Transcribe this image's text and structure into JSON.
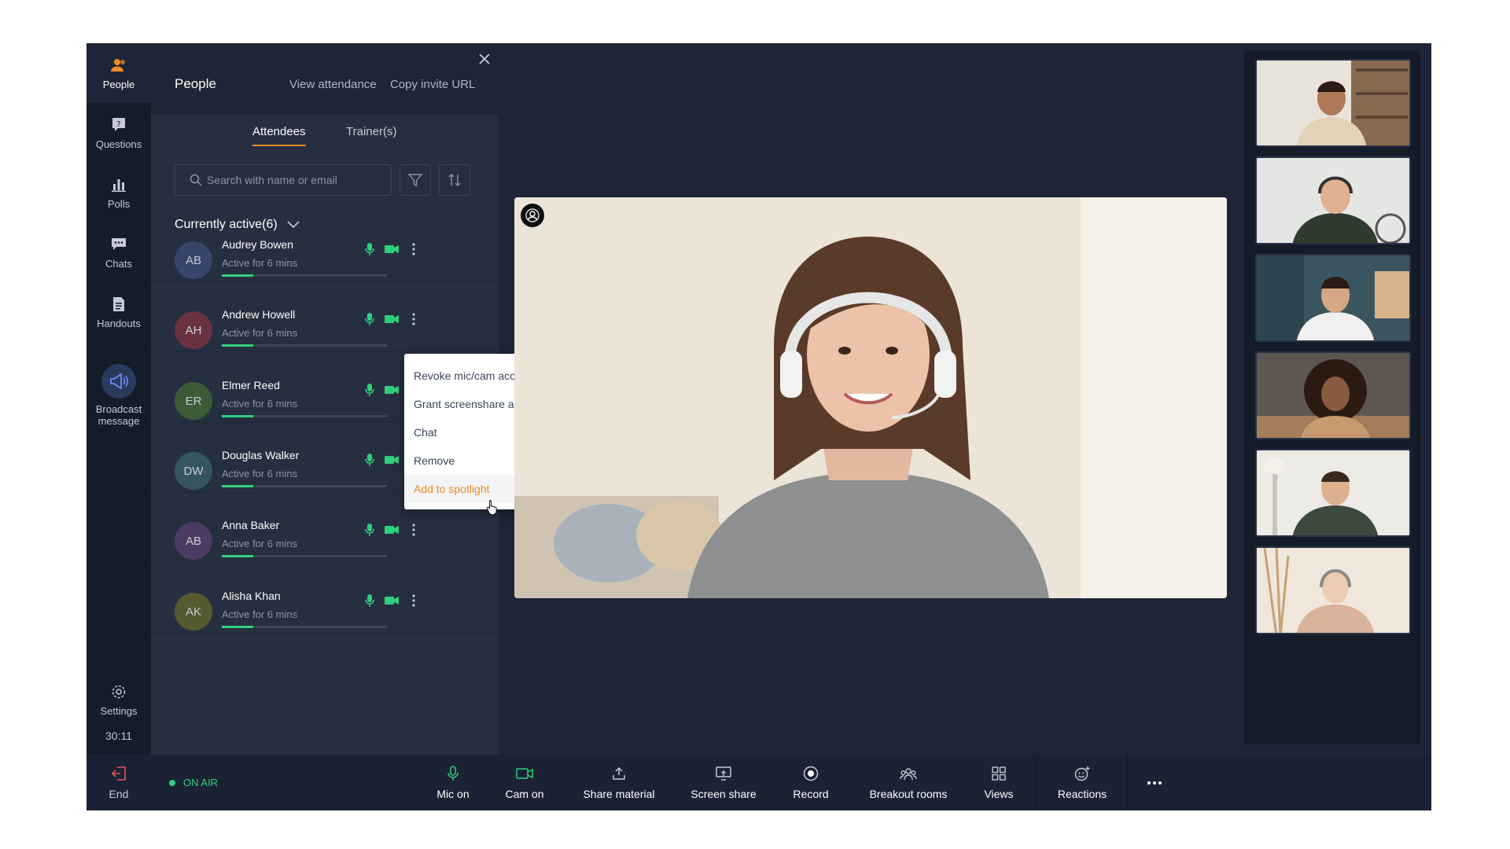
{
  "colors": {
    "accent": "#f08a24",
    "green": "#2fd07c",
    "end_red": "#e8515c"
  },
  "rail": {
    "items": [
      {
        "label": "People",
        "icon": "people-icon",
        "active": true
      },
      {
        "label": "Questions",
        "icon": "question-icon"
      },
      {
        "label": "Polls",
        "icon": "poll-icon"
      },
      {
        "label": "Chats",
        "icon": "chat-icon"
      },
      {
        "label": "Handouts",
        "icon": "document-icon"
      }
    ],
    "broadcast_label": "Broadcast message",
    "settings_label": "Settings",
    "timer": "30:11",
    "end_label": "End"
  },
  "panel": {
    "title": "People",
    "view_attendance": "View attendance",
    "copy_invite": "Copy invite URL",
    "tabs": [
      "Attendees",
      "Trainer(s)"
    ],
    "search_placeholder": "Search with name or email",
    "section_label": "Currently active(6)"
  },
  "people": [
    {
      "initials": "AB",
      "name": "Audrey Bowen",
      "status": "Active for 6 mins",
      "progress": 0.19,
      "avatar_color": "#38456a"
    },
    {
      "initials": "AH",
      "name": "Andrew Howell",
      "status": "Active for 6 mins",
      "progress": 0.19,
      "avatar_color": "#6a3240"
    },
    {
      "initials": "ER",
      "name": "Elmer Reed",
      "status": "Active for 6 mins",
      "progress": 0.19,
      "avatar_color": "#3b5a35"
    },
    {
      "initials": "DW",
      "name": "Douglas Walker",
      "status": "Active for 6 mins",
      "progress": 0.19,
      "avatar_color": "#34565e"
    },
    {
      "initials": "AB",
      "name": "Anna Baker",
      "status": "Active for 6 mins",
      "progress": 0.19,
      "avatar_color": "#4c3a64"
    },
    {
      "initials": "AK",
      "name": "Alisha Khan",
      "status": "Active for 6 mins",
      "progress": 0.19,
      "avatar_color": "#555a30"
    }
  ],
  "menu": {
    "items": [
      "Revoke mic/cam access",
      "Grant screenshare access",
      "Chat",
      "Remove",
      "Add to spotlight"
    ],
    "highlighted": "Add to spotlight"
  },
  "bottom": {
    "on_air": "ON AIR",
    "buttons": [
      {
        "label": "Mic on",
        "icon": "mic-icon"
      },
      {
        "label": "Cam on",
        "icon": "camera-icon"
      },
      {
        "label": "Share material",
        "icon": "share-icon"
      },
      {
        "label": "Screen share",
        "icon": "screen-share-icon"
      },
      {
        "label": "Record",
        "icon": "record-icon"
      },
      {
        "label": "Breakout rooms",
        "icon": "breakout-icon"
      },
      {
        "label": "Views",
        "icon": "grid-icon"
      },
      {
        "label": "Reactions",
        "icon": "reaction-icon"
      }
    ],
    "more": "more-icon"
  }
}
